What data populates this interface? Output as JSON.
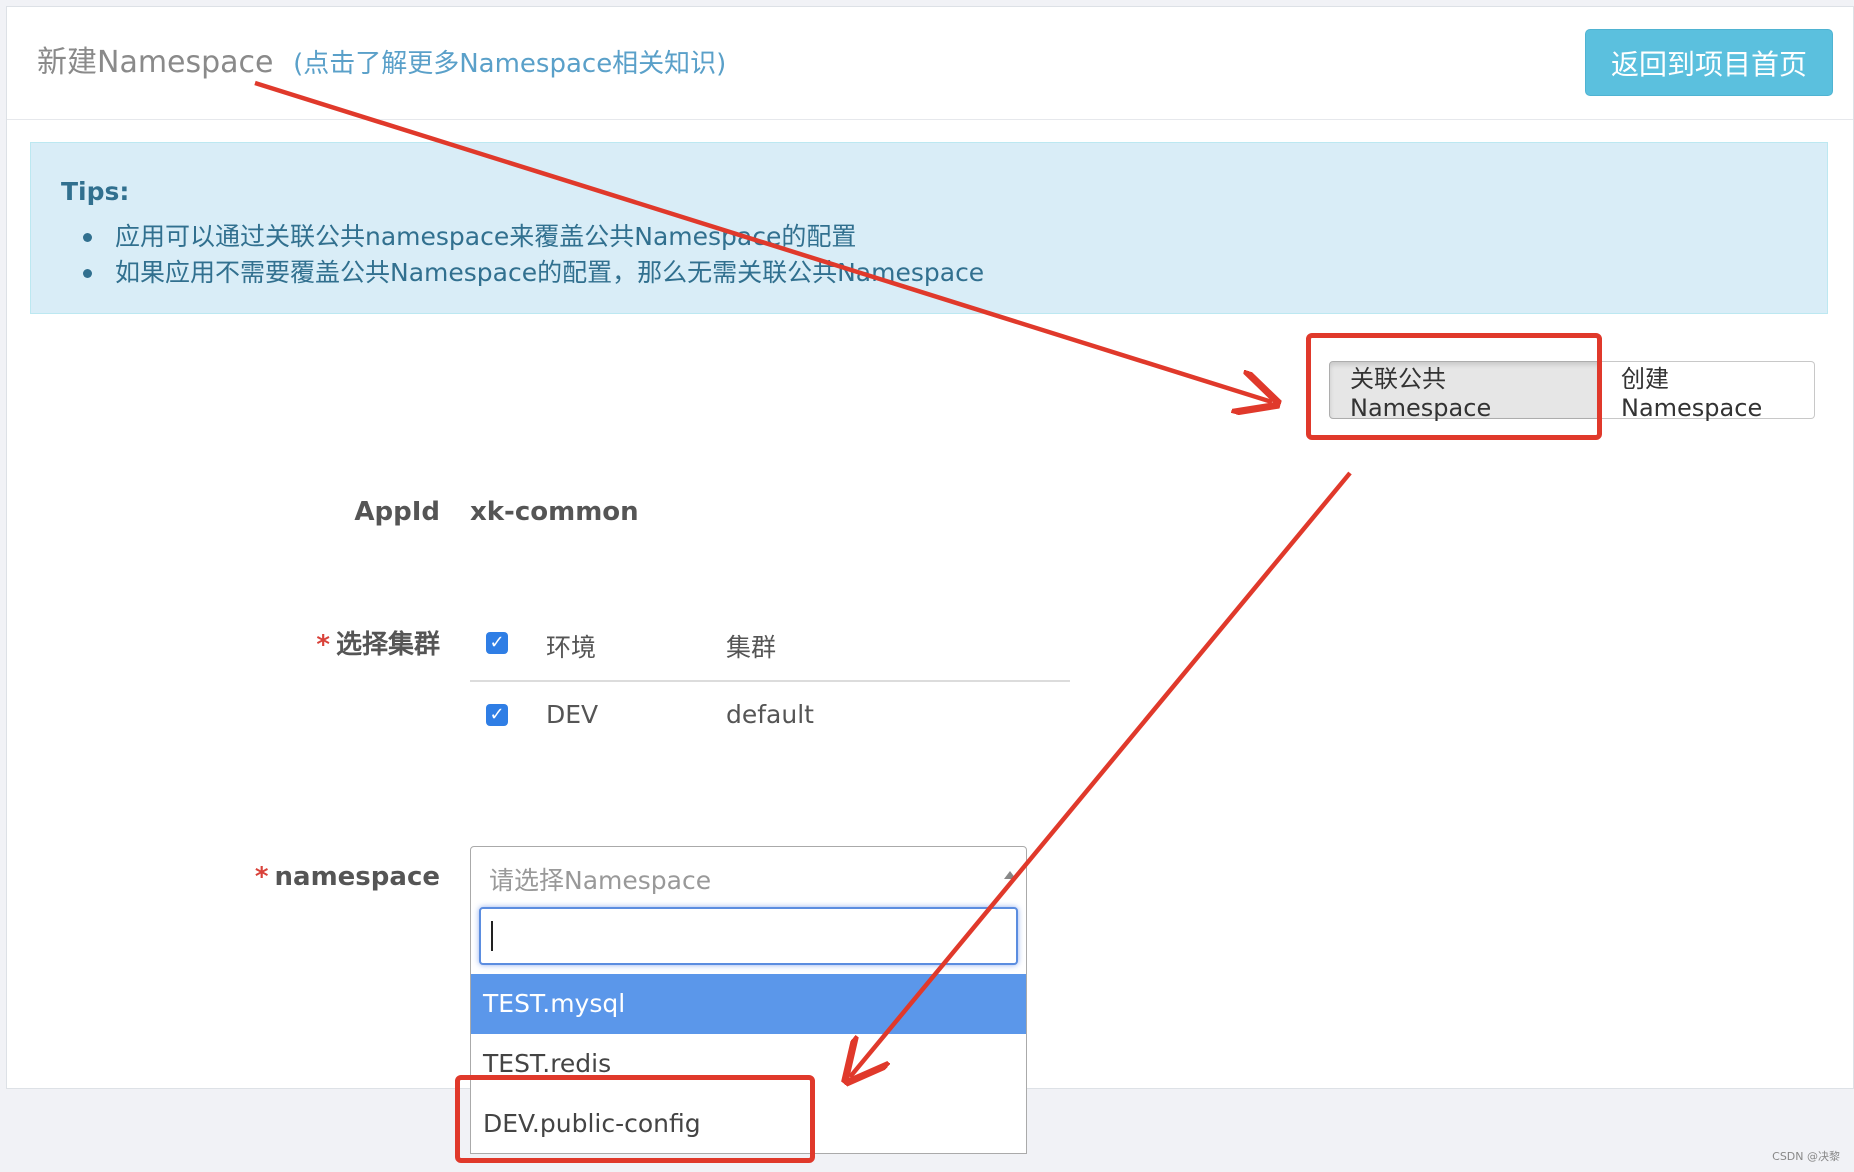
{
  "header": {
    "title": "新建Namespace",
    "help_link": "(点击了解更多Namespace相关知识)",
    "back_button": "返回到项目首页"
  },
  "tips": {
    "title": "Tips:",
    "items": [
      "应用可以通过关联公共namespace来覆盖公共Namespace的配置",
      "如果应用不需要覆盖公共Namespace的配置，那么无需关联公共Namespace"
    ]
  },
  "mode_tabs": {
    "associate": "关联公共Namespace",
    "create": "创建Namespace",
    "active": "associate"
  },
  "form": {
    "appid_label": "AppId",
    "appid_value": "xk-common",
    "required_mark": "*",
    "cluster_label": "选择集群",
    "cluster_table": {
      "head": {
        "env": "环境",
        "cluster": "集群",
        "checked": true
      },
      "rows": [
        {
          "env": "DEV",
          "cluster": "default",
          "checked": true
        }
      ]
    },
    "namespace_label": "namespace",
    "namespace_placeholder": "请选择Namespace",
    "search_value": "",
    "options": [
      "TEST.mysql",
      "TEST.redis",
      "DEV.public-config"
    ],
    "highlighted_option": "TEST.mysql"
  },
  "annotation_color": "#e0392b",
  "watermark": "CSDN @决黎"
}
